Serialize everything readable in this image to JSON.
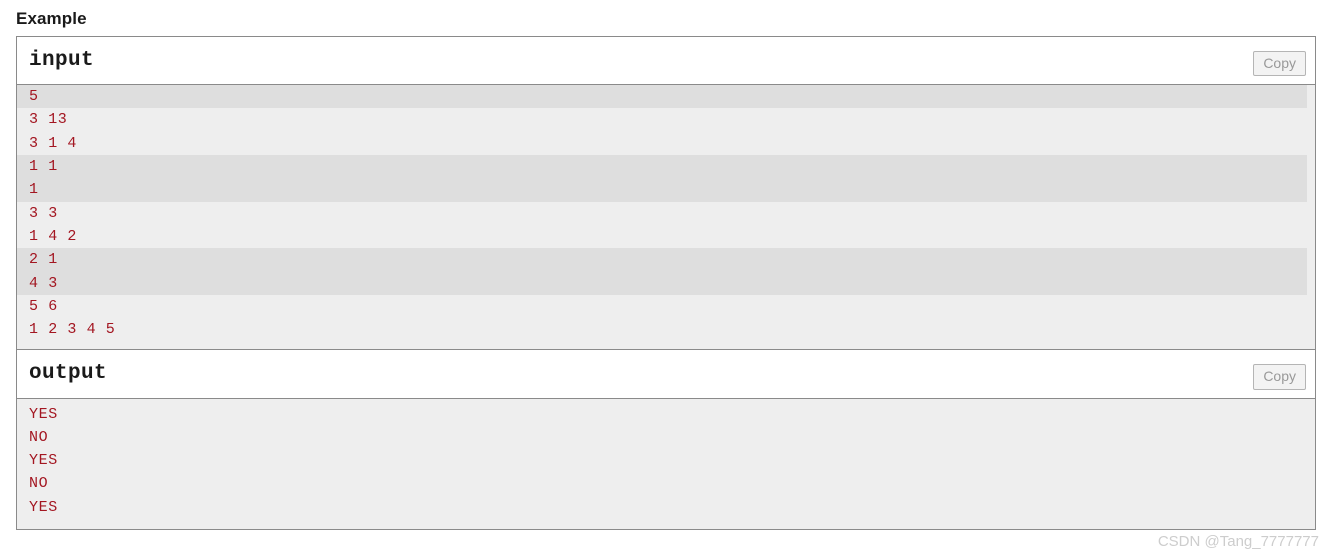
{
  "page": {
    "heading": "Example",
    "watermark": "CSDN @Tang_7777777"
  },
  "colors": {
    "text_data": "#a31621",
    "border": "#8a8a8a",
    "stripe_dark": "#dedede",
    "stripe_light": "#eeeeee",
    "copy_label": "#999999"
  },
  "sample_tests": [
    {
      "title": "input",
      "copy_label": "Copy",
      "lines": [
        {
          "text": "5",
          "stripe": "dark"
        },
        {
          "text": "3 13",
          "stripe": "light"
        },
        {
          "text": "3 1 4",
          "stripe": "light"
        },
        {
          "text": "1 1",
          "stripe": "dark"
        },
        {
          "text": "1",
          "stripe": "dark"
        },
        {
          "text": "3 3",
          "stripe": "light"
        },
        {
          "text": "1 4 2",
          "stripe": "light"
        },
        {
          "text": "2 1",
          "stripe": "dark"
        },
        {
          "text": "4 3",
          "stripe": "dark"
        },
        {
          "text": "5 6",
          "stripe": "light"
        },
        {
          "text": "1 2 3 4 5",
          "stripe": "light"
        }
      ]
    },
    {
      "title": "output",
      "copy_label": "Copy",
      "lines": [
        {
          "text": "YES",
          "stripe": "light"
        },
        {
          "text": "NO",
          "stripe": "light"
        },
        {
          "text": "YES",
          "stripe": "light"
        },
        {
          "text": "NO",
          "stripe": "light"
        },
        {
          "text": "YES",
          "stripe": "light"
        }
      ]
    }
  ]
}
